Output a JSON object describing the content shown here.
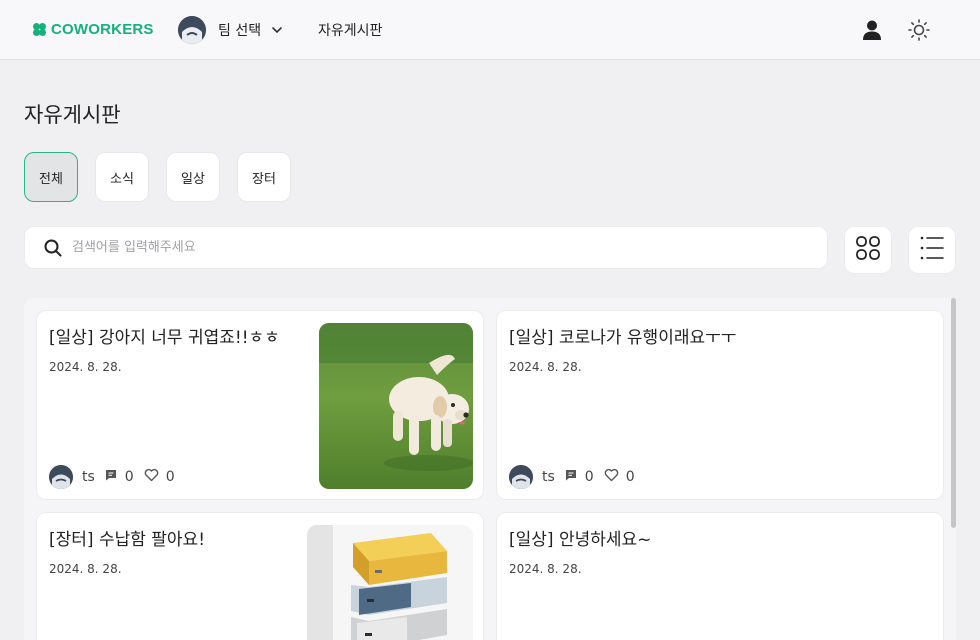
{
  "header": {
    "logo": "COWORKERS",
    "team_label": "팀 선택",
    "nav_link": "자유게시판"
  },
  "page": {
    "title": "자유게시판",
    "filters": [
      "전체",
      "소식",
      "일상",
      "장터"
    ],
    "active_filter": "전체",
    "search_placeholder": "검색어를 입력해주세요",
    "search_value": ""
  },
  "view_modes": [
    "grid-view",
    "list-view"
  ],
  "posts": [
    {
      "title": "[일상] 강아지 너무 귀엽죠!!ㅎㅎ",
      "date": "2024. 8. 28.",
      "author": "ts",
      "comments": "0",
      "likes": "0",
      "thumbnail": "puppy-photo"
    },
    {
      "title": "[일상] 코로나가 유행이래요ㅜㅜ",
      "date": "2024. 8. 28.",
      "author": "ts",
      "comments": "0",
      "likes": "0"
    },
    {
      "title": "[장터] 수납함 팔아요!",
      "date": "2024. 8. 28.",
      "thumbnail": "drawer-photo"
    },
    {
      "title": "[일상] 안녕하세요~",
      "date": "2024. 8. 28."
    }
  ],
  "colors": {
    "brand": "#16b07a",
    "active_border": "#2bb585",
    "background": "#f0f0f2"
  }
}
